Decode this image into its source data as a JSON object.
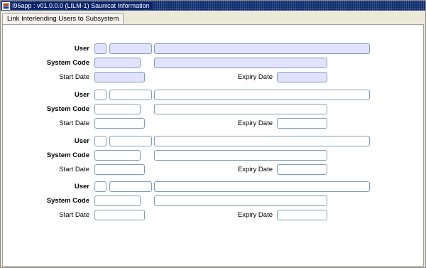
{
  "window": {
    "title": "I96app : v01.0.0.0 (LILM-1) Saunicat Information"
  },
  "tabs": [
    {
      "label": "Link Interlending Users to Subsystem",
      "active": true
    }
  ],
  "labels": {
    "user": "User",
    "system_code": "System Code",
    "start_date": "Start Date",
    "expiry_date": "Expiry Date"
  },
  "records": [
    {
      "highlighted": true,
      "user_check": "",
      "user_code": "",
      "user_name": "",
      "system_code": "",
      "system_name": "",
      "start_date": "",
      "expiry_date": ""
    },
    {
      "highlighted": false,
      "user_check": "",
      "user_code": "",
      "user_name": "",
      "system_code": "",
      "system_name": "",
      "start_date": "",
      "expiry_date": ""
    },
    {
      "highlighted": false,
      "user_check": "",
      "user_code": "",
      "user_name": "",
      "system_code": "",
      "system_name": "",
      "start_date": "",
      "expiry_date": ""
    },
    {
      "highlighted": false,
      "user_check": "",
      "user_code": "",
      "user_name": "",
      "system_code": "",
      "system_name": "",
      "start_date": "",
      "expiry_date": ""
    }
  ],
  "colors": {
    "title_bar": "#0a246a",
    "field_highlight": "#e1e2fc",
    "field_border": "#7f9db9"
  }
}
